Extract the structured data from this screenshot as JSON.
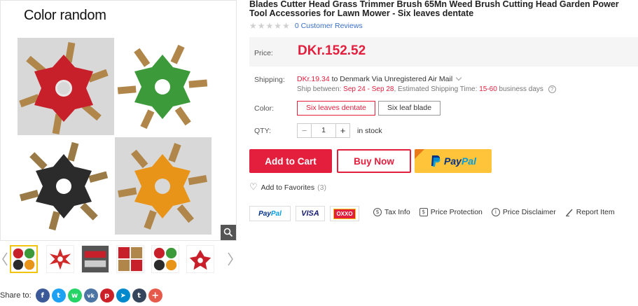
{
  "gallery": {
    "main_caption": "Color random",
    "thumbnail_count": 6,
    "share_label": "Share to:",
    "share_networks": [
      {
        "name": "facebook-icon",
        "glyph": "f",
        "color": "#3b5998"
      },
      {
        "name": "twitter-icon",
        "glyph": "t",
        "color": "#1da1f2"
      },
      {
        "name": "whatsapp-icon",
        "glyph": "w",
        "color": "#25d366"
      },
      {
        "name": "vk-icon",
        "glyph": "vk",
        "color": "#4c75a3"
      },
      {
        "name": "pinterest-icon",
        "glyph": "p",
        "color": "#cb2027"
      },
      {
        "name": "telegram-icon",
        "glyph": "➤",
        "color": "#0088cc"
      },
      {
        "name": "tumblr-icon",
        "glyph": "t",
        "color": "#35465c"
      },
      {
        "name": "more-icon",
        "glyph": "+",
        "color": "#e65a4b"
      }
    ]
  },
  "product": {
    "title": "Blades Cutter Head Grass Trimmer Brush 65Mn Weed Brush Cutting Head Garden Power Tool Accessories for Lawn Mower - Six leaves dentate",
    "reviews_link": "0 Customer Reviews",
    "rating_stars": 0
  },
  "price": {
    "label": "Price:",
    "value": "DKr.152.52"
  },
  "shipping": {
    "label": "Shipping:",
    "cost": "DKr.19.34",
    "destination_text": "to Denmark Via Unregistered Air Mail",
    "between_prefix": "Ship between:",
    "dates": "Sep 24 - Sep 28",
    "estimated_prefix": ", Estimated Shipping Time:",
    "estimated_days": "15-60",
    "days_suffix": "business days"
  },
  "color": {
    "label": "Color:",
    "options": [
      "Six leaves dentate",
      "Six leaf blade"
    ],
    "selected": "Six leaves dentate"
  },
  "quantity": {
    "label": "QTY:",
    "value": "1",
    "stock": "in stock"
  },
  "actions": {
    "add_to_cart": "Add to Cart",
    "buy_now": "Buy Now",
    "paypal_part1": "Pay",
    "paypal_part2": "Pal",
    "favorites": "Add to Favorites",
    "favorites_count": "(3)"
  },
  "payment_badges": {
    "paypal_part1": "Pay",
    "paypal_part2": "Pal",
    "visa": "VISA",
    "oxxo": "OXXO"
  },
  "info_links": [
    {
      "name": "tax-info",
      "label": "Tax Info",
      "icon": "tax-icon"
    },
    {
      "name": "price-protection",
      "label": "Price Protection",
      "icon": "shield-icon"
    },
    {
      "name": "price-disclaimer",
      "label": "Price Disclaimer",
      "icon": "info-icon"
    },
    {
      "name": "report-item",
      "label": "Report Item",
      "icon": "pen-icon"
    }
  ],
  "colors": {
    "accent_red": "#e31f3d",
    "link_blue": "#3a6fc9",
    "paypal_yellow": "#ffc439",
    "blade_red": "#c8202a",
    "blade_green": "#3d9a3a",
    "blade_black": "#2b2b2b",
    "blade_orange": "#e89419"
  }
}
